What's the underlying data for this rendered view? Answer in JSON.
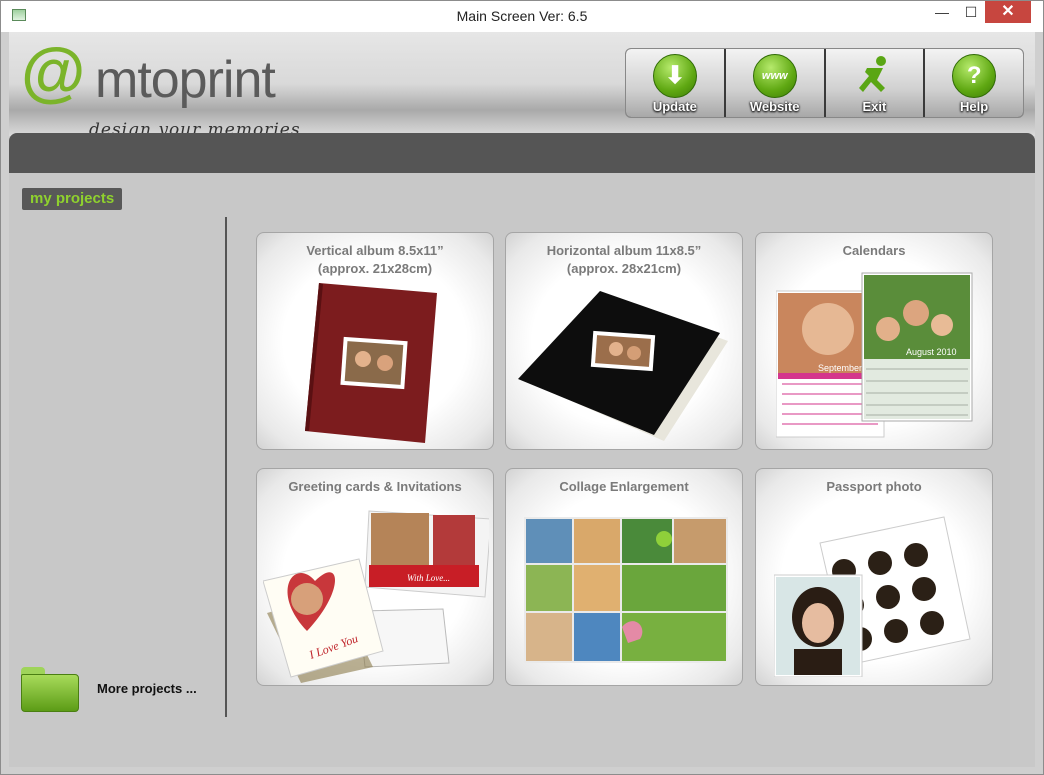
{
  "window": {
    "title": "Main Screen  Ver: 6.5",
    "min": "—",
    "max": "☐",
    "close": "✕"
  },
  "logo": {
    "at": "@",
    "word": "mtoprint",
    "tagline": "design  your memories"
  },
  "toolbar": {
    "update": "Update",
    "website": "Website",
    "exit": "Exit",
    "help": "Help",
    "www": "www",
    "help_glyph": "?",
    "update_glyph": "⬇"
  },
  "sidebar": {
    "label": "my projects",
    "more_label": "More projects ..."
  },
  "cards": [
    {
      "title": "Vertical album 8.5x11”\n(approx. 21x28cm)"
    },
    {
      "title": "Horizontal album 11x8.5”\n(approx. 28x21cm)"
    },
    {
      "title": "Calendars",
      "cal1": "September",
      "cal2": "August 2010"
    },
    {
      "title": "Greeting cards & Invitations",
      "card_text": "With Love...",
      "heart_text": "I Love You"
    },
    {
      "title": "Collage Enlargement"
    },
    {
      "title": "Passport photo"
    }
  ],
  "colors": {
    "accent": "#7bb42a",
    "dark": "#555555",
    "close": "#c7463f"
  }
}
